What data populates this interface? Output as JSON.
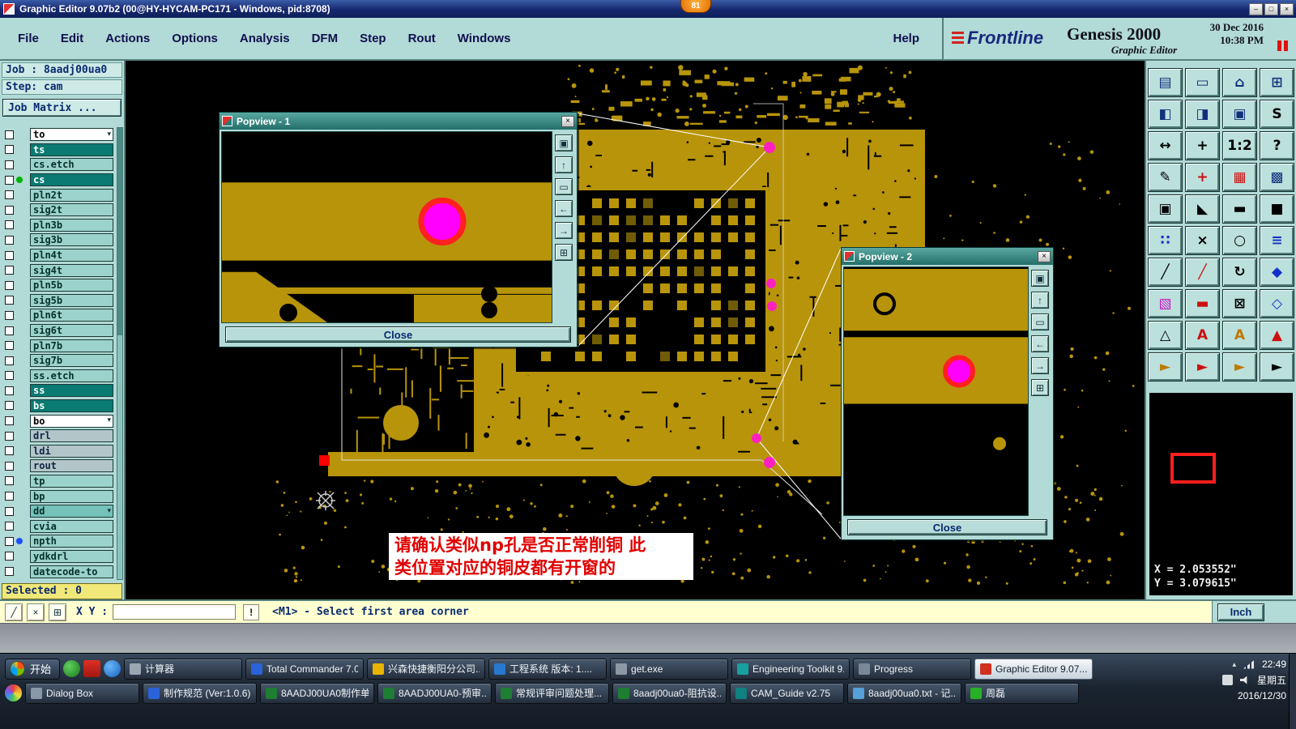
{
  "titlebar": {
    "title": "Graphic Editor 9.07b2 (00@HY-HYCAM-PC171 - Windows, pid:8708)",
    "badge": "81"
  },
  "window_controls": {
    "minimize": "–",
    "maximize": "□",
    "close": "×"
  },
  "menubar": {
    "items": [
      "File",
      "Edit",
      "Actions",
      "Options",
      "Analysis",
      "DFM",
      "Step",
      "Rout",
      "Windows"
    ],
    "help": "Help"
  },
  "brand": {
    "logo": "Frontline",
    "product": "Genesis 2000",
    "date": "30 Dec 2016",
    "time": "10:38 PM",
    "subtitle": "Graphic Editor"
  },
  "jobpanel": {
    "job": "Job : 8aadj00ua0",
    "step": "Step: cam",
    "matrix_button": "Job Matrix ..."
  },
  "layers": {
    "selected_label": "Selected : 0",
    "items": [
      {
        "name": "to",
        "variant": "white",
        "arrow": true
      },
      {
        "name": "ts",
        "variant": "dark"
      },
      {
        "name": "cs.etch",
        "variant": "light"
      },
      {
        "name": "cs",
        "variant": "dark",
        "dot": "#00b400"
      },
      {
        "name": "pln2t",
        "variant": "light"
      },
      {
        "name": "sig2t",
        "variant": "light"
      },
      {
        "name": "pln3b",
        "variant": "light"
      },
      {
        "name": "sig3b",
        "variant": "light"
      },
      {
        "name": "pln4t",
        "variant": "light"
      },
      {
        "name": "sig4t",
        "variant": "light"
      },
      {
        "name": "pln5b",
        "variant": "light"
      },
      {
        "name": "sig5b",
        "variant": "light"
      },
      {
        "name": "pln6t",
        "variant": "light"
      },
      {
        "name": "sig6t",
        "variant": "light"
      },
      {
        "name": "pln7b",
        "variant": "light"
      },
      {
        "name": "sig7b",
        "variant": "light"
      },
      {
        "name": "ss.etch",
        "variant": "light"
      },
      {
        "name": "ss",
        "variant": "dark"
      },
      {
        "name": "bs",
        "variant": "dark"
      },
      {
        "name": "bo",
        "variant": "white",
        "arrow": true
      },
      {
        "name": "drl",
        "variant": "gray"
      },
      {
        "name": "ldi",
        "variant": "gray"
      },
      {
        "name": "rout",
        "variant": "gray"
      },
      {
        "name": "tp",
        "variant": "light"
      },
      {
        "name": "bp",
        "variant": "light"
      },
      {
        "name": "dd",
        "variant": "mid",
        "arrow": true
      },
      {
        "name": "cvia",
        "variant": "light"
      },
      {
        "name": "npth",
        "variant": "light",
        "dot": "#1e50ff"
      },
      {
        "name": "ydkdrl",
        "variant": "light"
      },
      {
        "name": "datecode-to",
        "variant": "light"
      }
    ]
  },
  "popviews": {
    "pv1_title": "Popview - 1",
    "pv2_title": "Popview - 2",
    "close_label": "Close",
    "buttons": [
      {
        "name": "window",
        "glyph": "▣"
      },
      {
        "name": "raise",
        "glyph": "↑"
      },
      {
        "name": "screen",
        "glyph": "▭"
      },
      {
        "name": "pan-left",
        "glyph": "←"
      },
      {
        "name": "pan-right",
        "glyph": "→"
      },
      {
        "name": "fit",
        "glyph": "⊞"
      }
    ]
  },
  "annotation": {
    "line1": "请确认类似np孔是否正常削铜 此",
    "line2": "类位置对应的铜皮都有开窗的"
  },
  "toolbar": {
    "buttons": [
      {
        "name": "clipboard",
        "glyph": "▤",
        "color": "#10307c"
      },
      {
        "name": "screen",
        "glyph": "▭",
        "color": "#10307c"
      },
      {
        "name": "home",
        "glyph": "⌂",
        "color": "#10307c"
      },
      {
        "name": "tile",
        "glyph": "⊞",
        "color": "#10307c"
      },
      {
        "name": "zoom-prev",
        "glyph": "◧",
        "color": "#10307c"
      },
      {
        "name": "zoom-next",
        "glyph": "◨",
        "color": "#10307c"
      },
      {
        "name": "cascade",
        "glyph": "▣",
        "color": "#10307c"
      },
      {
        "name": "snap",
        "glyph": "S",
        "color": "#000000"
      },
      {
        "name": "fit-width",
        "glyph": "↔",
        "color": "#000000"
      },
      {
        "name": "center",
        "glyph": "+",
        "color": "#000000"
      },
      {
        "name": "zoom-1-2",
        "glyph": "1:2",
        "color": "#000000"
      },
      {
        "name": "help",
        "glyph": "?",
        "color": "#000000"
      },
      {
        "name": "measure",
        "glyph": "✎",
        "color": "#000000"
      },
      {
        "name": "pin",
        "glyph": "+",
        "color": "#cc1010"
      },
      {
        "name": "layer-colors",
        "glyph": "▦",
        "color": "#cc1010"
      },
      {
        "name": "mat",
        "glyph": "▩",
        "color": "#10307c"
      },
      {
        "name": "film",
        "glyph": "▣",
        "color": "#000000"
      },
      {
        "name": "flag",
        "glyph": "◣",
        "color": "#000000"
      },
      {
        "name": "ruler",
        "glyph": "▬",
        "color": "#000000"
      },
      {
        "name": "fill",
        "glyph": "■",
        "color": "#000000"
      },
      {
        "name": "nets",
        "glyph": "∷",
        "color": "#1030c8"
      },
      {
        "name": "delete",
        "glyph": "×",
        "color": "#000000"
      },
      {
        "name": "pads",
        "glyph": "○",
        "color": "#000000"
      },
      {
        "name": "stack",
        "glyph": "≡",
        "color": "#1030c8"
      },
      {
        "name": "line",
        "glyph": "╱",
        "color": "#000000"
      },
      {
        "name": "arc",
        "glyph": "╱",
        "color": "#cc1010"
      },
      {
        "name": "redo",
        "glyph": "↻",
        "color": "#000000"
      },
      {
        "name": "surface",
        "glyph": "◆",
        "color": "#1030c8"
      },
      {
        "name": "highlight",
        "glyph": "▧",
        "color": "#c818c8"
      },
      {
        "name": "erase",
        "glyph": "▬",
        "color": "#cc1010"
      },
      {
        "name": "origin",
        "glyph": "⊠",
        "color": "#000000"
      },
      {
        "name": "polygon",
        "glyph": "◇",
        "color": "#1030c8"
      },
      {
        "name": "triangle-outline",
        "glyph": "△",
        "color": "#000000"
      },
      {
        "name": "text-red",
        "glyph": "A",
        "color": "#cc1010"
      },
      {
        "name": "text-yellow",
        "glyph": "A",
        "color": "#c07800"
      },
      {
        "name": "triangle-red",
        "glyph": "▲",
        "color": "#cc1010"
      },
      {
        "name": "select-yellow",
        "glyph": "►",
        "color": "#c07800"
      },
      {
        "name": "select-red",
        "glyph": "►",
        "color": "#cc1010"
      },
      {
        "name": "select-crosshair",
        "glyph": "►",
        "color": "#c07800"
      },
      {
        "name": "select-black",
        "glyph": "►",
        "color": "#000000"
      }
    ]
  },
  "coords": {
    "x": "X = 2.053552\"",
    "y": "Y = 3.079615\""
  },
  "statusbar": {
    "tools": [
      {
        "name": "profile",
        "glyph": "╱"
      },
      {
        "name": "clear",
        "glyph": "×"
      },
      {
        "name": "grid",
        "glyph": "⊞"
      }
    ],
    "xy_label": "X Y :",
    "input_value": "",
    "bang": "!",
    "prompt": "<M1> - Select first area corner",
    "unit": "Inch"
  },
  "taskbar": {
    "start": "开始",
    "row1": [
      {
        "label": "计算器",
        "icon": "#9aa6b2"
      },
      {
        "label": "Total Commander 7.0 ...",
        "icon": "#2a62d8"
      },
      {
        "label": "兴森快捷衡阳分公司...",
        "icon": "#e8b400"
      },
      {
        "label": "工程系统 版本: 1....",
        "icon": "#2878d0"
      },
      {
        "label": "get.exe",
        "icon": "#8c98a4"
      },
      {
        "label": "Engineering Toolkit 9....",
        "icon": "#18a0a0"
      },
      {
        "label": "Progress",
        "icon": "#788898"
      },
      {
        "label": "Graphic Editor 9.07...",
        "icon": "#d03020",
        "active": true
      }
    ],
    "row2": [
      {
        "label": "Dialog Box",
        "icon": "#8898a8"
      },
      {
        "label": "制作规范 (Ver:1.0.6)",
        "icon": "#2a62d8"
      },
      {
        "label": "8AADJ00UA0制作单...",
        "icon": "#1e7e34"
      },
      {
        "label": "8AADJ00UA0-预审...",
        "icon": "#1e7e34"
      },
      {
        "label": "常规评审问题处理...",
        "icon": "#1e7e34"
      },
      {
        "label": "8aadj00ua0-阻抗设...",
        "icon": "#1e7e34"
      },
      {
        "label": "CAM_Guide v2.75",
        "icon": "#108080"
      },
      {
        "label": "8aadj00ua0.txt - 记...",
        "icon": "#58a0d8"
      },
      {
        "label": "周磊",
        "icon": "#28b028"
      }
    ],
    "tray": {
      "time": "22:49",
      "weekday": "星期五",
      "date": "2016/12/30"
    }
  },
  "icons": {
    "combo_arrow": "▾",
    "tray_chevron": "▴",
    "popview_close": "×"
  }
}
